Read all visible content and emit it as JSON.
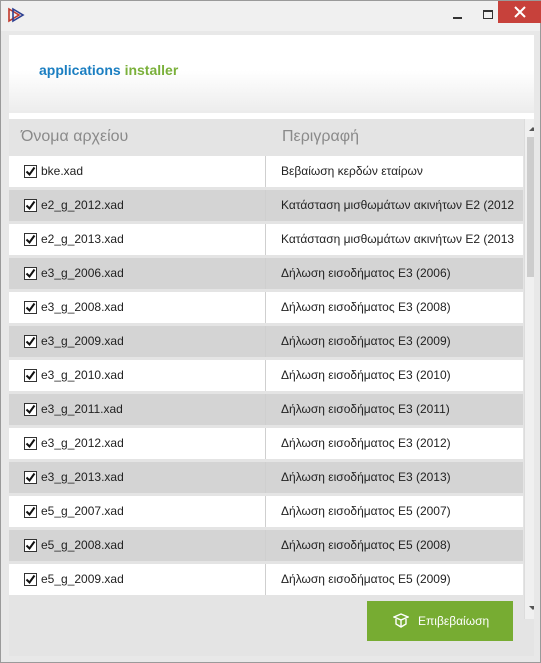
{
  "brand": {
    "part1": "applications",
    "part2": "installer"
  },
  "columns": {
    "name": "Όνομα αρχείου",
    "description": "Περιγραφή"
  },
  "rows": [
    {
      "name": "bke.xad",
      "description": "Βεβαίωση κερδών εταίρων",
      "checked": true
    },
    {
      "name": "e2_g_2012.xad",
      "description": "Κατάσταση μισθωμάτων ακινήτων Ε2 (2012",
      "checked": true
    },
    {
      "name": "e2_g_2013.xad",
      "description": "Κατάσταση μισθωμάτων ακινήτων Ε2 (2013",
      "checked": true
    },
    {
      "name": "e3_g_2006.xad",
      "description": "Δήλωση εισοδήματος Ε3 (2006)",
      "checked": true
    },
    {
      "name": "e3_g_2008.xad",
      "description": "Δήλωση εισοδήματος Ε3 (2008)",
      "checked": true
    },
    {
      "name": "e3_g_2009.xad",
      "description": "Δήλωση εισοδήματος Ε3 (2009)",
      "checked": true
    },
    {
      "name": "e3_g_2010.xad",
      "description": "Δήλωση εισοδήματος Ε3 (2010)",
      "checked": true
    },
    {
      "name": "e3_g_2011.xad",
      "description": "Δήλωση εισοδήματος Ε3 (2011)",
      "checked": true
    },
    {
      "name": "e3_g_2012.xad",
      "description": "Δήλωση εισοδήματος Ε3 (2012)",
      "checked": true
    },
    {
      "name": "e3_g_2013.xad",
      "description": "Δήλωση εισοδήματος Ε3 (2013)",
      "checked": true
    },
    {
      "name": "e5_g_2007.xad",
      "description": "Δήλωση εισοδήματος Ε5 (2007)",
      "checked": true
    },
    {
      "name": "e5_g_2008.xad",
      "description": "Δήλωση εισοδήματος Ε5 (2008)",
      "checked": true
    },
    {
      "name": "e5_g_2009.xad",
      "description": "Δήλωση εισοδήματος Ε5 (2009)",
      "checked": true
    }
  ],
  "confirm": {
    "label": "Επιβεβαίωση",
    "icon": "package-icon"
  },
  "colors": {
    "brand_blue": "#1a7ec1",
    "brand_green": "#7ab03a",
    "button_green": "#77ac32",
    "close_red": "#c7413b"
  }
}
